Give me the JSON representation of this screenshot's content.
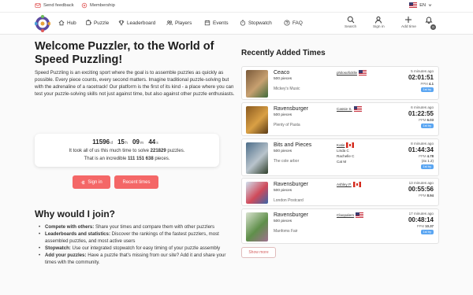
{
  "topbar": {
    "feedback_label": "Send feedback",
    "membership_label": "Membership",
    "language": "EN"
  },
  "nav": {
    "items": [
      {
        "label": "Hub",
        "icon": "house-icon"
      },
      {
        "label": "Puzzle",
        "icon": "puzzle-icon"
      },
      {
        "label": "Leaderboard",
        "icon": "trophy-icon"
      },
      {
        "label": "Players",
        "icon": "users-icon"
      },
      {
        "label": "Events",
        "icon": "calendar-icon"
      },
      {
        "label": "Stopwatch",
        "icon": "stopwatch-icon"
      },
      {
        "label": "FAQ",
        "icon": "question-icon"
      }
    ],
    "search_label": "Search",
    "signin_label": "Sign in",
    "addtime_label": "Add time",
    "notification_count": "0"
  },
  "hero": {
    "title": "Welcome Puzzler, to the World of Speed Puzzling!",
    "text": "Speed Puzzling is an exciting sport where the goal is to assemble puzzles as quickly as possible. Every piece counts, every second matters. Imagine traditional puzzle-solving but with the adrenaline of a racetrack! Our platform is the first of its kind - a place where you can test your puzzle-solving skills not just against time, but also against other puzzle enthusiasts."
  },
  "stats": {
    "days": "11596",
    "days_unit": "d",
    "hours": "15",
    "hours_unit": "h",
    "minutes": "09",
    "minutes_unit": "m",
    "seconds": "44",
    "seconds_unit": "s",
    "line1_prefix": "It took all of us this much time to solve",
    "puzzles_count": "221829",
    "line1_suffix": "puzzles.",
    "line2_prefix": "That is an incredible",
    "pieces_count": "111 151 638",
    "line2_suffix": "pieces."
  },
  "buttons": {
    "signin": "Sign in",
    "recent_times": "Recent times"
  },
  "why": {
    "title": "Why would I join?",
    "items": [
      {
        "bold": "Compete with others:",
        "text": "Share your times and compare them with other puzzlers"
      },
      {
        "bold": "Leaderboards and statistics:",
        "text": "Discover the rankings of the fastest puzzlers, most assembled puzzles, and most active users"
      },
      {
        "bold": "Stopwatch:",
        "text": "Use our integrated stopwatch for easy timing of your puzzle assembly"
      },
      {
        "bold": "Add your puzzles:",
        "text": "Have a puzzle that's missing from our site? Add it and share your times with the community."
      }
    ]
  },
  "recent": {
    "title": "Recently Added Times",
    "show_more": "Show more",
    "rows": [
      {
        "name": "Ceaco",
        "pieces": "500 pieces",
        "theme": "Mickey's Music",
        "player": "philosoficklle",
        "flag": "us",
        "others": [],
        "ago": "5 minutes ago",
        "time": "02:01:51",
        "ppm": "4.1",
        "extra": "",
        "first_try": "1st try",
        "thumb": [
          "#7a5a3a",
          "#c7a070",
          "#3f6a3a"
        ]
      },
      {
        "name": "Ravensburger",
        "pieces": "500 pieces",
        "theme": "Plenty of Pasta",
        "player": "Cassie S.",
        "flag": "us",
        "others": [],
        "ago": "6 minutes ago",
        "time": "01:22:55",
        "ppm": "6.03",
        "extra": "",
        "first_try": "1st try",
        "thumb": [
          "#8a5a1f",
          "#d9a045",
          "#5a3a14"
        ]
      },
      {
        "name": "Bits and Pieces",
        "pieces": "500 pieces",
        "theme": "The cole arbor",
        "player": "Katie",
        "flag": "ca",
        "others": [
          "Linda C",
          "Rachelle C",
          "Cat M"
        ],
        "ago": "8 minutes ago",
        "time": "01:44:34",
        "ppm": "4.78",
        "extra": "(4x 1.2)",
        "first_try": "1st try",
        "thumb": [
          "#4d6e8a",
          "#b9c4cc",
          "#2f3f2a"
        ]
      },
      {
        "name": "Ravensburger",
        "pieces": "500 pieces",
        "theme": "London Postcard",
        "player": "Ashley P.",
        "flag": "ca",
        "others": [],
        "ago": "13 minutes ago",
        "time": "00:55:56",
        "ppm": "8.94",
        "extra": "",
        "first_try": "",
        "thumb": [
          "#cfe0ee",
          "#d04a5a",
          "#3a66a8"
        ]
      },
      {
        "name": "Ravensburger",
        "pieces": "500 pieces",
        "theme": "Manfoms Fair",
        "player": "Claopalern",
        "flag": "us",
        "others": [],
        "ago": "17 minutes ago",
        "time": "00:48:14",
        "ppm": "10.37",
        "extra": "",
        "first_try": "1st try",
        "thumb": [
          "#d9e3d0",
          "#5f8f4a",
          "#a07090"
        ]
      }
    ]
  }
}
